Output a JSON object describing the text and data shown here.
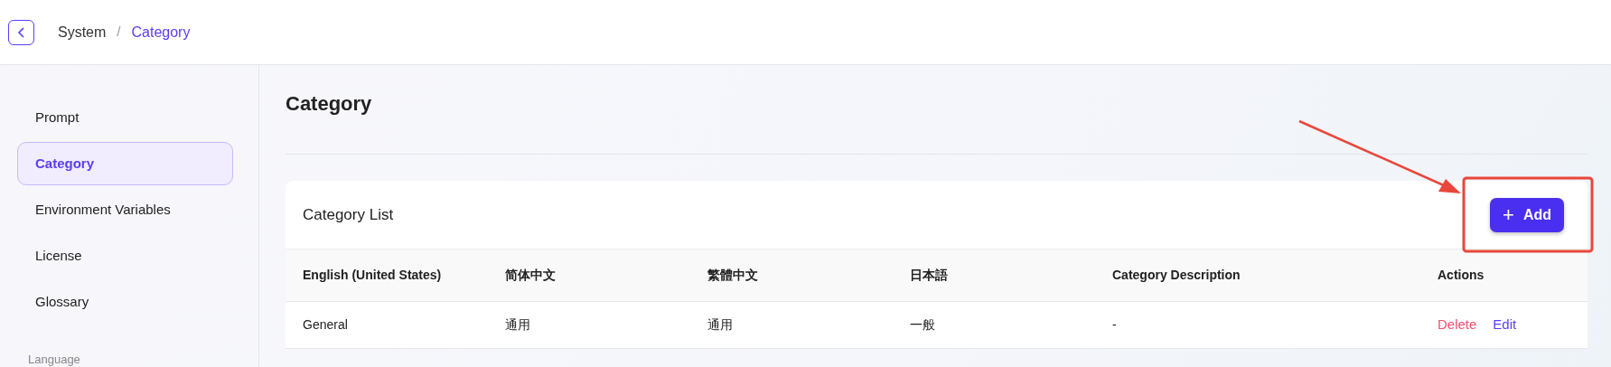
{
  "breadcrumb_separator": "/",
  "breadcrumb": [
    {
      "label": "System",
      "selected": false
    },
    {
      "label": "Category",
      "selected": true
    }
  ],
  "sidebar": {
    "items": [
      {
        "label": "Prompt",
        "selected": false
      },
      {
        "label": "Category",
        "selected": true
      },
      {
        "label": "Environment Variables",
        "selected": false
      },
      {
        "label": "License",
        "selected": false
      },
      {
        "label": "Glossary",
        "selected": false
      }
    ],
    "section_label": "Language"
  },
  "page_title": "Category",
  "card": {
    "title": "Category List",
    "add_button": {
      "icon": "+",
      "label": "Add"
    },
    "table": {
      "columns": [
        "English (United States)",
        "简体中文",
        "繁體中文",
        "日本語",
        "Category Description",
        "Actions"
      ],
      "rows": [
        {
          "cells": [
            "General",
            "通用",
            "通用",
            "一般",
            "-"
          ],
          "actions": [
            {
              "label": "Delete",
              "kind": "danger"
            },
            {
              "label": "Edit",
              "kind": "primary"
            }
          ]
        }
      ]
    }
  }
}
